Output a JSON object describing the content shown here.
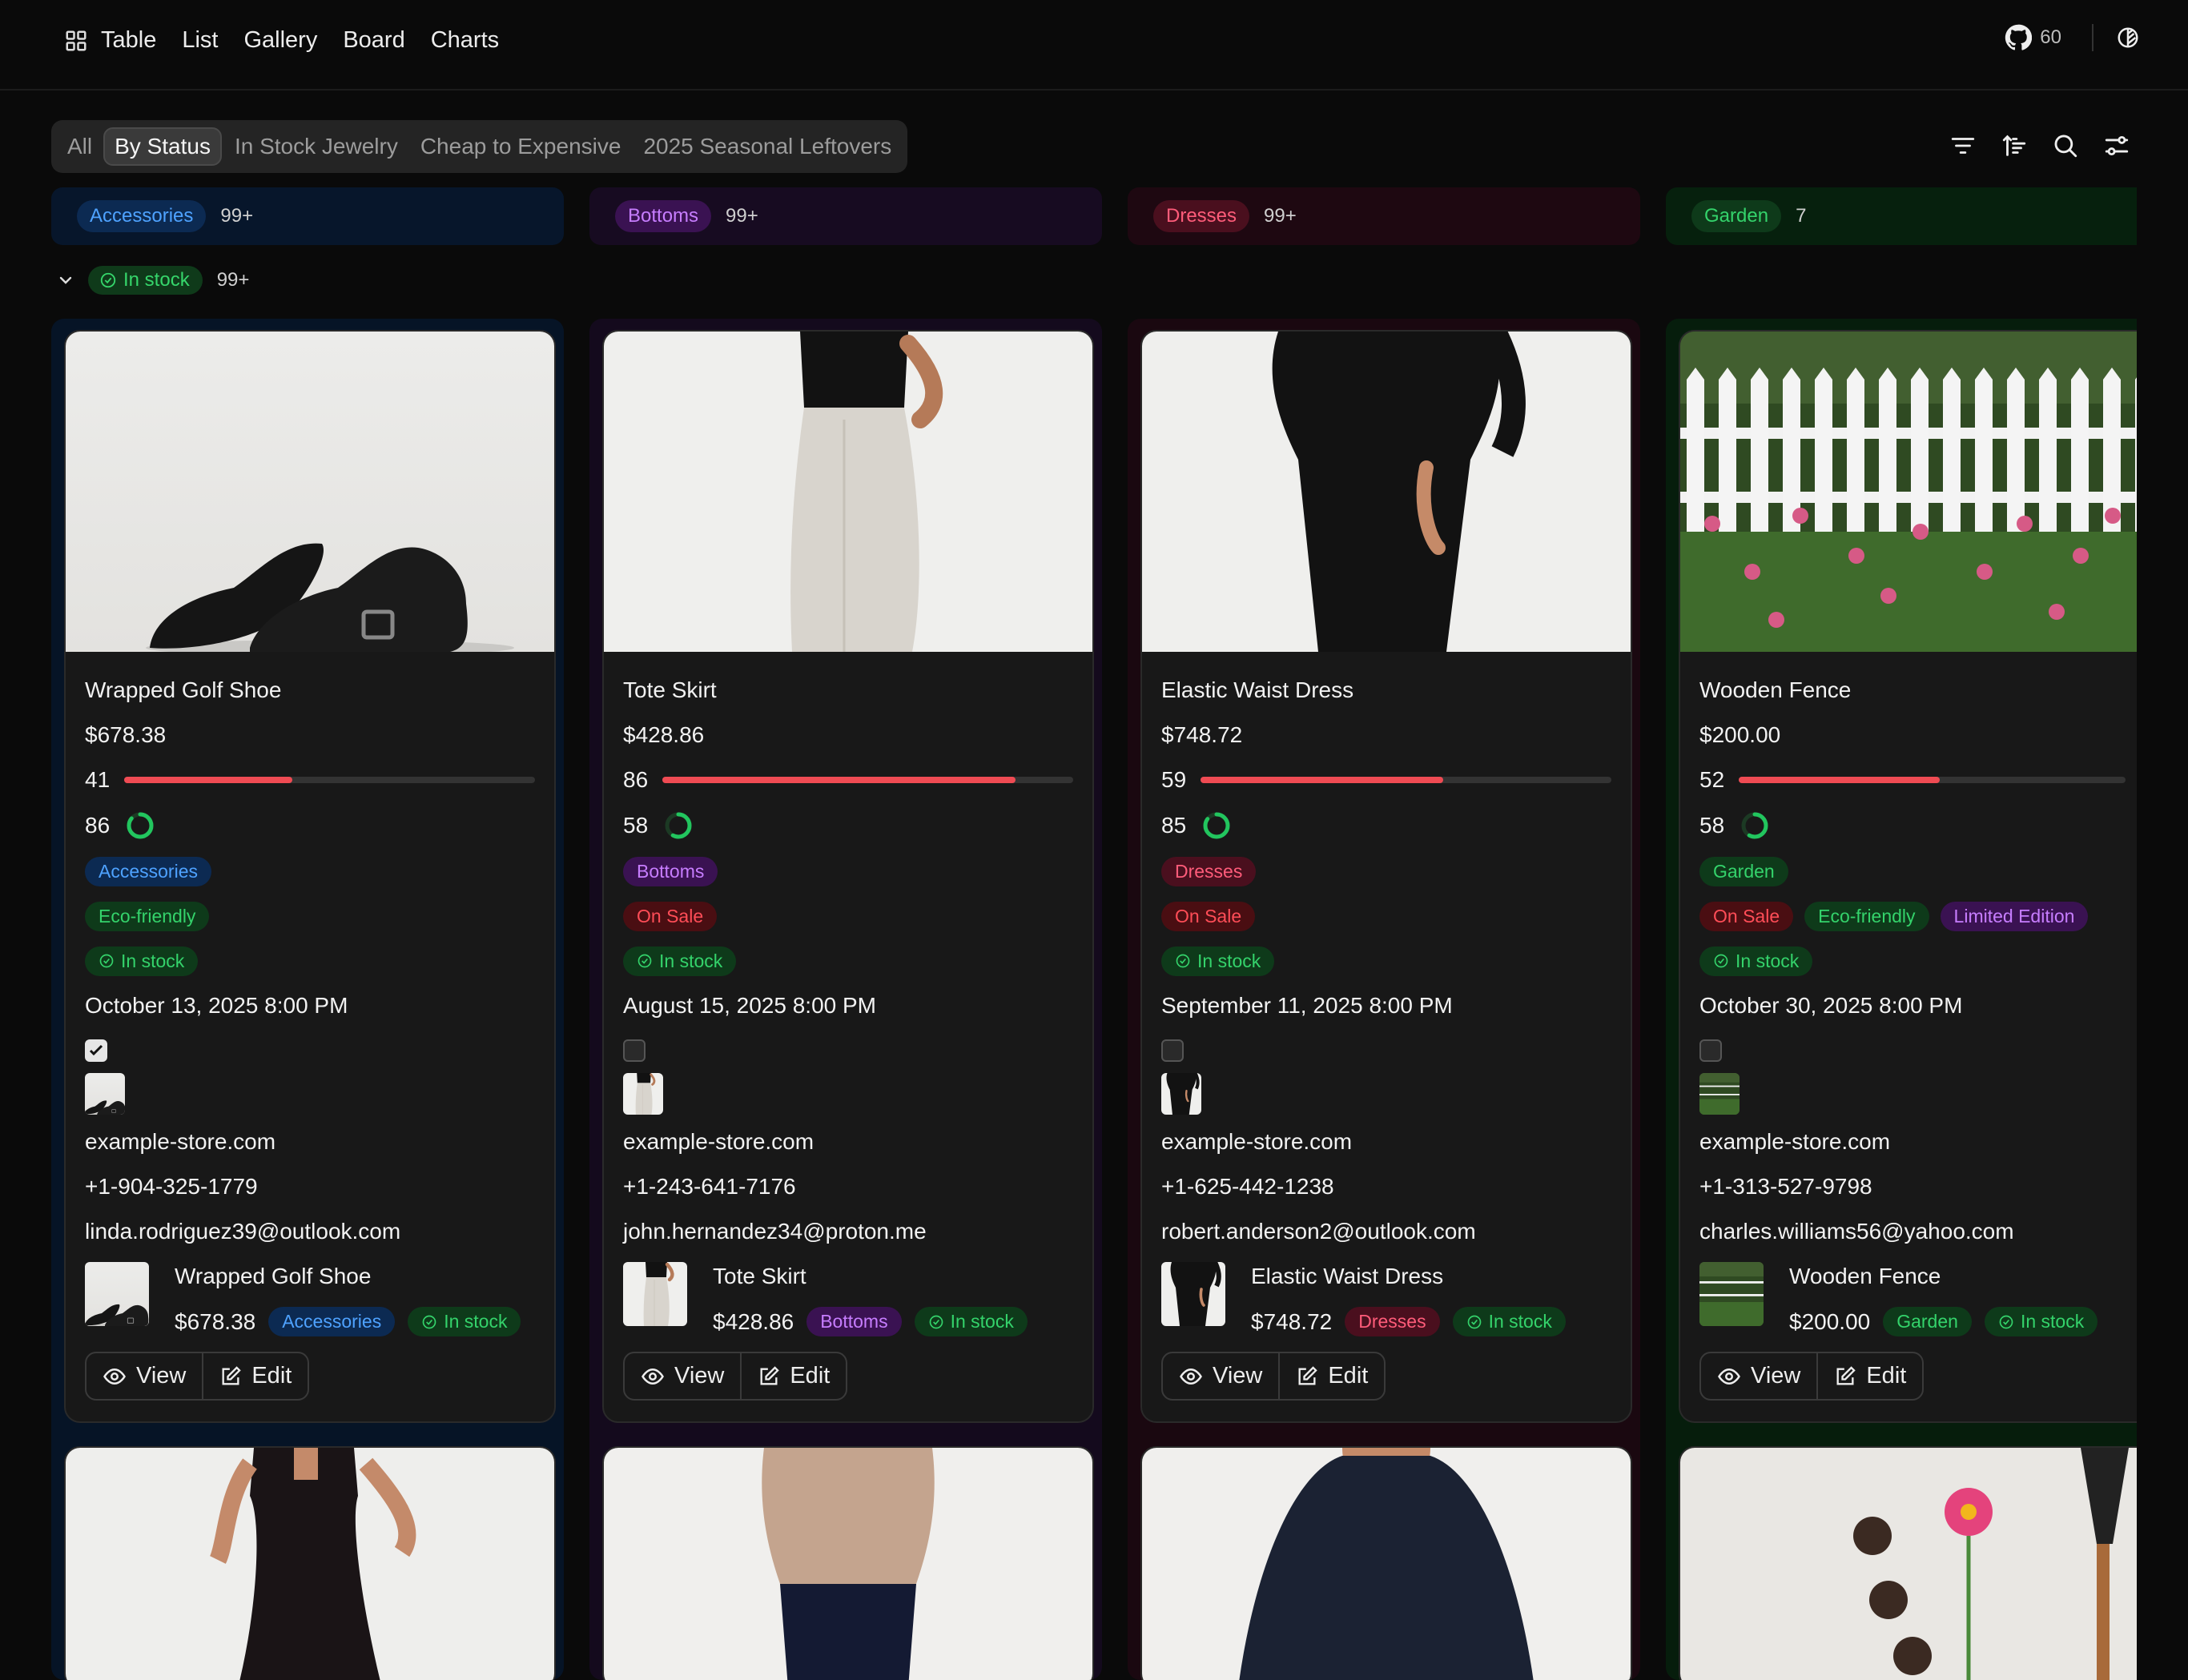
{
  "nav": {
    "items": [
      "Table",
      "List",
      "Gallery",
      "Board",
      "Charts"
    ],
    "github_stars": "60"
  },
  "views": {
    "tabs": [
      "All",
      "By Status",
      "In Stock Jewelry",
      "Cheap to Expensive",
      "2025 Seasonal Leftovers"
    ],
    "active": "By Status"
  },
  "toolbar_icons": [
    "filter-icon",
    "sort-icon",
    "search-icon",
    "settings-icon"
  ],
  "columns": [
    {
      "label": "Accessories",
      "count": "99+"
    },
    {
      "label": "Bottoms",
      "count": "99+"
    },
    {
      "label": "Dresses",
      "count": "99+"
    },
    {
      "label": "Garden",
      "count": "7"
    }
  ],
  "group": {
    "label": "In stock",
    "count": "99+"
  },
  "cards": [
    {
      "title": "Wrapped Golf Shoe",
      "price": "$678.38",
      "bar_value": "41",
      "bar_percent": 41,
      "ring_value": "86",
      "ring_percent": 86,
      "category": "Accessories",
      "tags": [
        "Eco-friendly"
      ],
      "status": "In stock",
      "date": "October 13, 2025 8:00 PM",
      "checked": true,
      "website": "example-store.com",
      "phone": "+1-904-325-1779",
      "email": "linda.rodriguez39@outlook.com",
      "view_label": "View",
      "edit_label": "Edit"
    },
    {
      "title": "Tote Skirt",
      "price": "$428.86",
      "bar_value": "86",
      "bar_percent": 86,
      "ring_value": "58",
      "ring_percent": 58,
      "category": "Bottoms",
      "tags": [
        "On Sale"
      ],
      "status": "In stock",
      "date": "August 15, 2025 8:00 PM",
      "checked": false,
      "website": "example-store.com",
      "phone": "+1-243-641-7176",
      "email": "john.hernandez34@proton.me",
      "view_label": "View",
      "edit_label": "Edit"
    },
    {
      "title": "Elastic Waist Dress",
      "price": "$748.72",
      "bar_value": "59",
      "bar_percent": 59,
      "ring_value": "85",
      "ring_percent": 85,
      "category": "Dresses",
      "tags": [
        "On Sale"
      ],
      "status": "In stock",
      "date": "September 11, 2025 8:00 PM",
      "checked": false,
      "website": "example-store.com",
      "phone": "+1-625-442-1238",
      "email": "robert.anderson2@outlook.com",
      "view_label": "View",
      "edit_label": "Edit"
    },
    {
      "title": "Wooden Fence",
      "price": "$200.00",
      "bar_value": "52",
      "bar_percent": 52,
      "ring_value": "58",
      "ring_percent": 58,
      "category": "Garden",
      "tags": [
        "On Sale",
        "Eco-friendly",
        "Limited Edition"
      ],
      "status": "In stock",
      "date": "October 30, 2025 8:00 PM",
      "checked": false,
      "website": "example-store.com",
      "phone": "+1-313-527-9798",
      "email": "charles.williams56@yahoo.com",
      "view_label": "View",
      "edit_label": "Edit"
    }
  ]
}
